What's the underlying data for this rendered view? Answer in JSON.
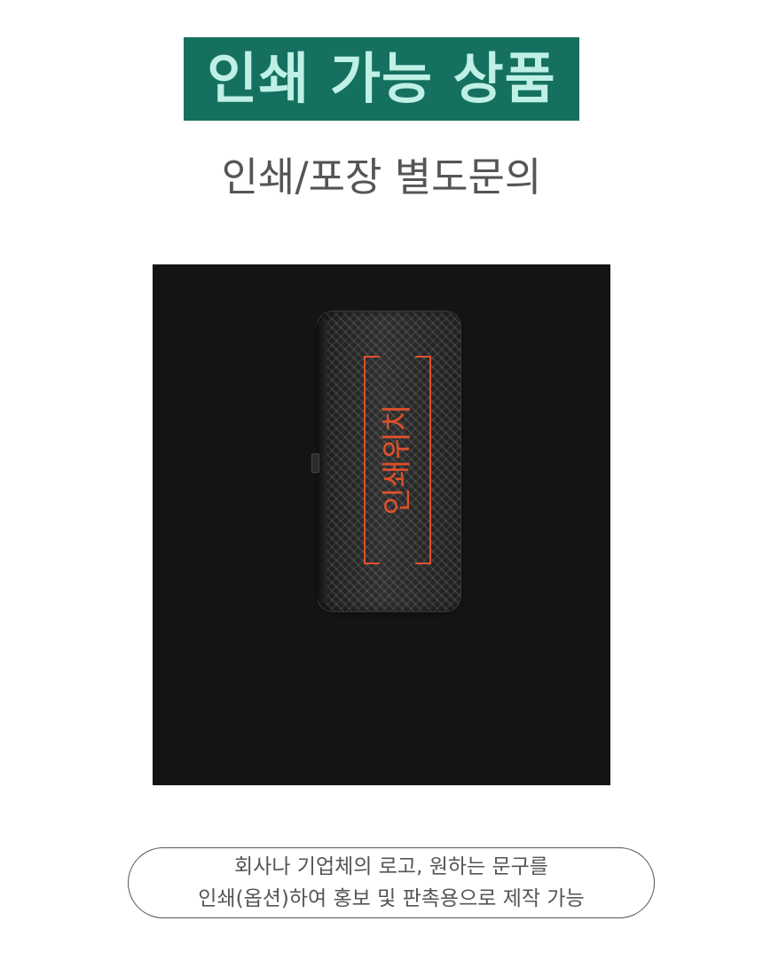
{
  "header": {
    "title": "인쇄 가능 상품",
    "subtitle": "인쇄/포장 별도문의"
  },
  "product": {
    "print_area_label": "인쇄위치"
  },
  "notice": {
    "line1": "회사나 기업체의 로고, 원하는 문구를",
    "line2": "인쇄(옵션)하여 홍보 및 판촉용으로 제작 가능"
  },
  "colors": {
    "badge_background": "#157060",
    "badge_text": "#bff0e6",
    "print_marker": "#e0502a",
    "panel_background": "#141414"
  }
}
